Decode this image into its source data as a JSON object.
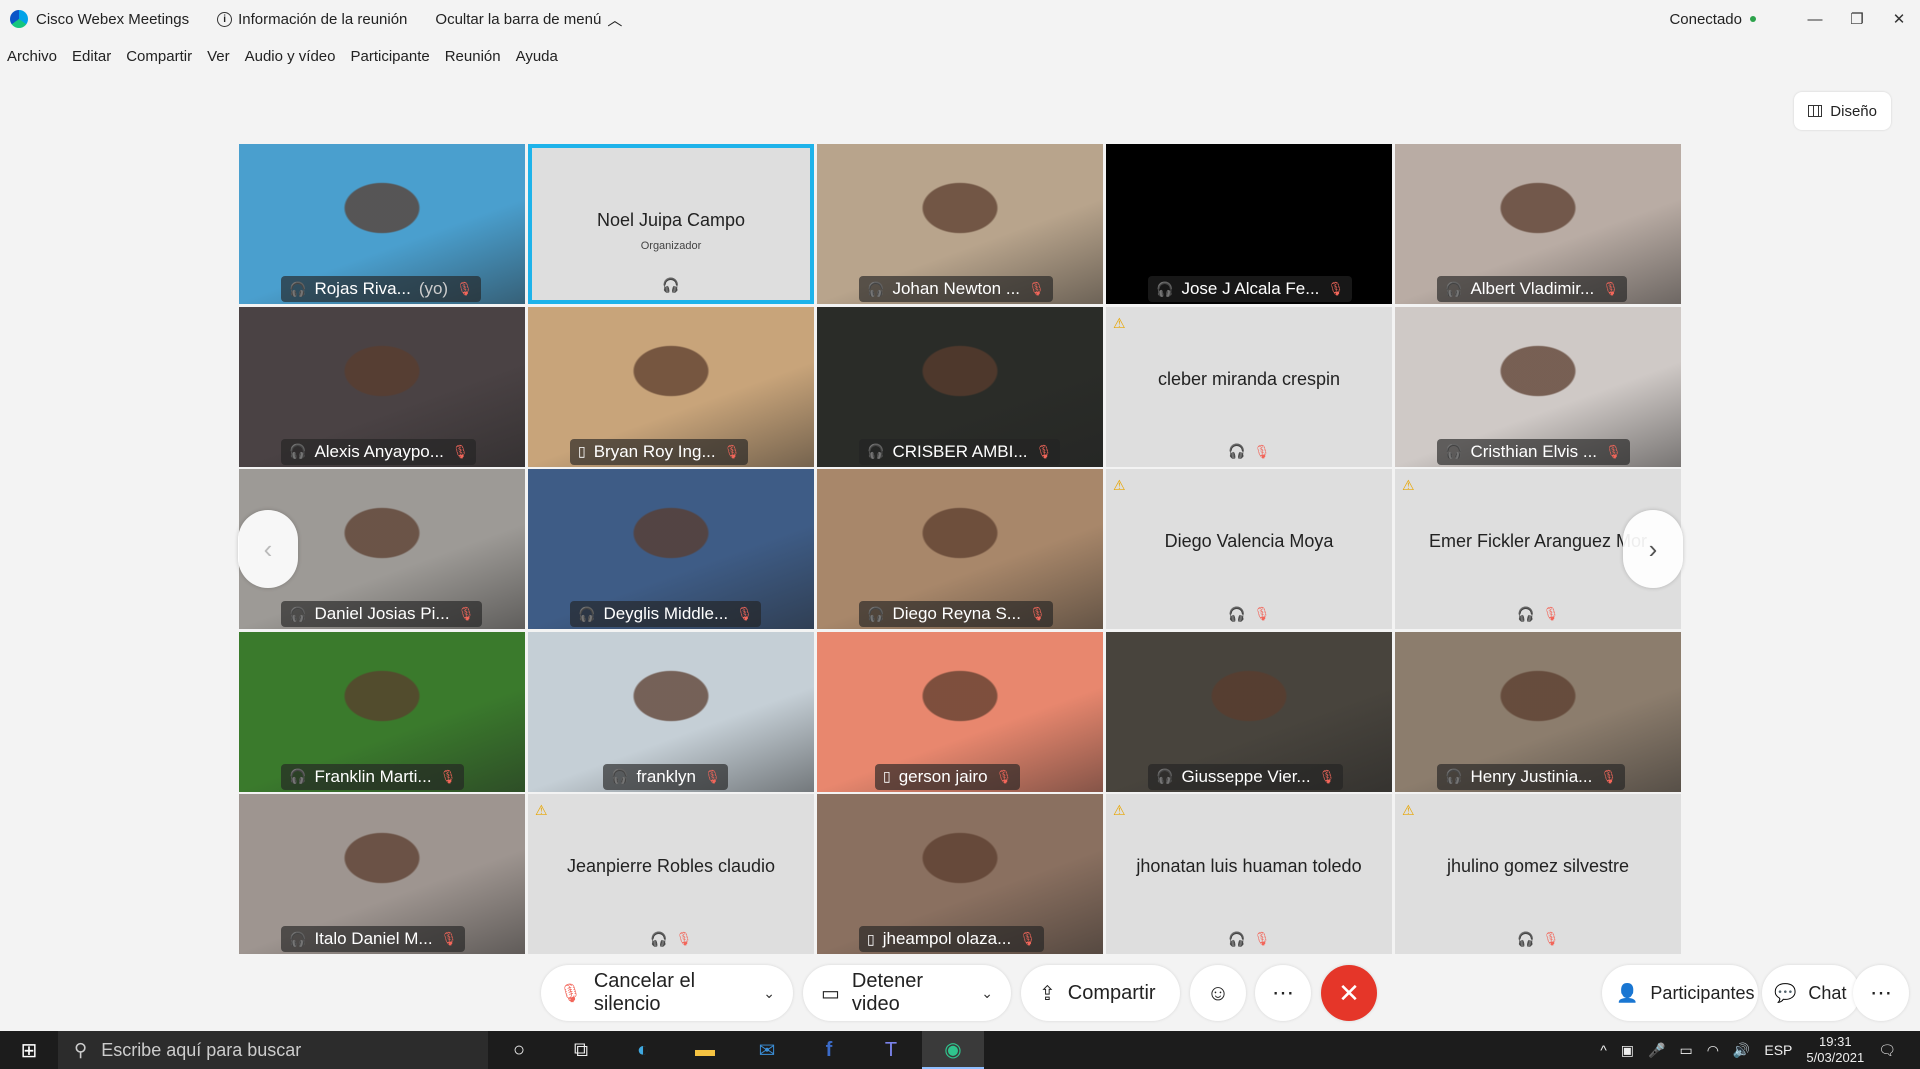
{
  "titlebar": {
    "app_title": "Cisco Webex Meetings",
    "meeting_info": "Información de la reunión",
    "hide_menu": "Ocultar la barra de menú",
    "status": "Conectado"
  },
  "menu": [
    "Archivo",
    "Editar",
    "Compartir",
    "Ver",
    "Audio y vídeo",
    "Participante",
    "Reunión",
    "Ayuda"
  ],
  "layout_button": "Diseño",
  "participants": [
    {
      "name": "Rojas Riva...",
      "suffix": "(yo)",
      "type": "video",
      "bg": "#4a9fce",
      "device": "headset"
    },
    {
      "name": "Noel Juipa Campo",
      "role": "Organizador",
      "type": "active",
      "device": "headset"
    },
    {
      "name": "Johan Newton ...",
      "type": "video",
      "bg": "#b8a48c",
      "device": "headset"
    },
    {
      "name": "Jose J Alcala Fe...",
      "type": "black",
      "device": "headset"
    },
    {
      "name": "Albert Vladimir...",
      "type": "video",
      "bg": "#b9aca4",
      "device": "headset"
    },
    {
      "name": "Alexis Anyaypo...",
      "type": "video",
      "bg": "#4a4244",
      "device": "headset"
    },
    {
      "name": "Bryan Roy Ing...",
      "type": "video",
      "bg": "#c8a47a",
      "device": "phone"
    },
    {
      "name": "CRISBER AMBI...",
      "type": "video",
      "bg": "#2a2c28",
      "device": "headset"
    },
    {
      "name": "cleber miranda crespin",
      "type": "noimg",
      "warn": true,
      "device": "headset"
    },
    {
      "name": "Cristhian Elvis ...",
      "type": "video",
      "bg": "#cfc9c6",
      "device": "headset"
    },
    {
      "name": "Daniel Josias Pi...",
      "type": "video",
      "bg": "#9d9a96",
      "device": "headset"
    },
    {
      "name": "Deyglis Middle...",
      "type": "video",
      "bg": "#3e5c86",
      "device": "headset"
    },
    {
      "name": "Diego Reyna S...",
      "type": "video",
      "bg": "#a8876a",
      "device": "headset"
    },
    {
      "name": "Diego Valencia Moya",
      "type": "noimg",
      "warn": true,
      "device": "headset"
    },
    {
      "name": "Emer Fickler Aranguez Mor",
      "type": "noimg",
      "warn": true,
      "device": "headset"
    },
    {
      "name": "Franklin Marti...",
      "type": "video",
      "bg": "#3a7a2c",
      "device": "headset"
    },
    {
      "name": "franklyn",
      "type": "video",
      "bg": "#c5cfd6",
      "device": "headset"
    },
    {
      "name": "gerson jairo",
      "type": "video",
      "bg": "#e8876e",
      "device": "phone"
    },
    {
      "name": "Giusseppe Vier...",
      "type": "video",
      "bg": "#48443d",
      "device": "headset"
    },
    {
      "name": "Henry Justinia...",
      "type": "video",
      "bg": "#8c7d6d",
      "device": "headset"
    },
    {
      "name": "Italo Daniel M...",
      "type": "video",
      "bg": "#9e9590",
      "device": "headset"
    },
    {
      "name": "Jeanpierre Robles claudio",
      "type": "noimg",
      "warn": true,
      "device": "headset"
    },
    {
      "name": "jheampol olaza...",
      "type": "video",
      "bg": "#8a7060",
      "device": "phone"
    },
    {
      "name": "jhonatan luis huaman toledo",
      "type": "noimg",
      "warn": true,
      "device": "headset"
    },
    {
      "name": "jhulino gomez silvestre",
      "type": "noimg",
      "warn": true,
      "device": "headset"
    }
  ],
  "controls": {
    "unmute": "Cancelar el silencio",
    "stop_video": "Detener video",
    "share": "Compartir",
    "participants": "Participantes",
    "chat": "Chat"
  },
  "taskbar": {
    "search_placeholder": "Escribe aquí para buscar",
    "language": "ESP",
    "time": "19:31",
    "date": "5/03/2021"
  },
  "colors": {
    "accent": "#1eb3ea",
    "end_call": "#e53629",
    "mute": "#f2665a",
    "status_green": "#2ca24b"
  }
}
